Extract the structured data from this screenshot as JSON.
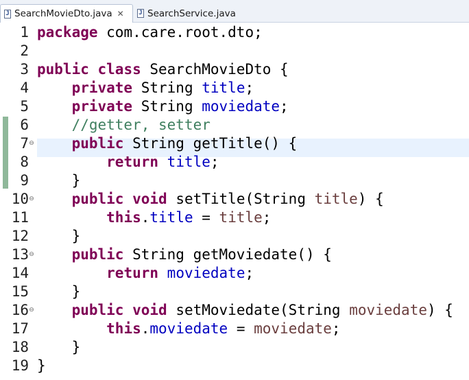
{
  "tabs": [
    {
      "label": "SearchMovieDto.java",
      "icon": "java-file-icon",
      "active": true,
      "close": "✕"
    },
    {
      "label": "SearchService.java",
      "icon": "java-file-icon",
      "active": false
    }
  ],
  "editor": {
    "highlighted_line": 6,
    "lines": [
      {
        "n": "1",
        "fold": "",
        "tokens": [
          {
            "t": "package",
            "c": "kw"
          },
          {
            "t": " com.care.root.dto;",
            "c": ""
          }
        ]
      },
      {
        "n": "2",
        "fold": "",
        "tokens": []
      },
      {
        "n": "3",
        "fold": "",
        "tokens": [
          {
            "t": "public",
            "c": "kw"
          },
          {
            "t": " ",
            "c": ""
          },
          {
            "t": "class",
            "c": "kw"
          },
          {
            "t": " SearchMovieDto {",
            "c": ""
          }
        ]
      },
      {
        "n": "4",
        "fold": "",
        "tokens": [
          {
            "t": "    ",
            "c": ""
          },
          {
            "t": "private",
            "c": "kw"
          },
          {
            "t": " String ",
            "c": ""
          },
          {
            "t": "title",
            "c": "fld"
          },
          {
            "t": ";",
            "c": ""
          }
        ]
      },
      {
        "n": "5",
        "fold": "",
        "tokens": [
          {
            "t": "    ",
            "c": ""
          },
          {
            "t": "private",
            "c": "kw"
          },
          {
            "t": " String ",
            "c": ""
          },
          {
            "t": "moviedate",
            "c": "fld"
          },
          {
            "t": ";",
            "c": ""
          }
        ]
      },
      {
        "n": "6",
        "fold": "",
        "tokens": [
          {
            "t": "    ",
            "c": ""
          },
          {
            "t": "//getter, setter",
            "c": "cmt"
          }
        ]
      },
      {
        "n": "7",
        "fold": "⊖",
        "tokens": [
          {
            "t": "    ",
            "c": ""
          },
          {
            "t": "public",
            "c": "kw"
          },
          {
            "t": " String getTitle() {",
            "c": ""
          }
        ]
      },
      {
        "n": "8",
        "fold": "",
        "tokens": [
          {
            "t": "        ",
            "c": ""
          },
          {
            "t": "return",
            "c": "kw"
          },
          {
            "t": " ",
            "c": ""
          },
          {
            "t": "title",
            "c": "fld"
          },
          {
            "t": ";",
            "c": ""
          }
        ]
      },
      {
        "n": "9",
        "fold": "",
        "tokens": [
          {
            "t": "    }",
            "c": ""
          }
        ]
      },
      {
        "n": "10",
        "fold": "⊖",
        "tokens": [
          {
            "t": "    ",
            "c": ""
          },
          {
            "t": "public",
            "c": "kw"
          },
          {
            "t": " ",
            "c": ""
          },
          {
            "t": "void",
            "c": "kw"
          },
          {
            "t": " setTitle(String ",
            "c": ""
          },
          {
            "t": "title",
            "c": "param"
          },
          {
            "t": ") {",
            "c": ""
          }
        ]
      },
      {
        "n": "11",
        "fold": "",
        "tokens": [
          {
            "t": "        ",
            "c": ""
          },
          {
            "t": "this",
            "c": "kw"
          },
          {
            "t": ".",
            "c": ""
          },
          {
            "t": "title",
            "c": "fld"
          },
          {
            "t": " = ",
            "c": ""
          },
          {
            "t": "title",
            "c": "param"
          },
          {
            "t": ";",
            "c": ""
          }
        ]
      },
      {
        "n": "12",
        "fold": "",
        "tokens": [
          {
            "t": "    }",
            "c": ""
          }
        ]
      },
      {
        "n": "13",
        "fold": "⊖",
        "tokens": [
          {
            "t": "    ",
            "c": ""
          },
          {
            "t": "public",
            "c": "kw"
          },
          {
            "t": " String getMoviedate() {",
            "c": ""
          }
        ]
      },
      {
        "n": "14",
        "fold": "",
        "tokens": [
          {
            "t": "        ",
            "c": ""
          },
          {
            "t": "return",
            "c": "kw"
          },
          {
            "t": " ",
            "c": ""
          },
          {
            "t": "moviedate",
            "c": "fld"
          },
          {
            "t": ";",
            "c": ""
          }
        ]
      },
      {
        "n": "15",
        "fold": "",
        "tokens": [
          {
            "t": "    }",
            "c": ""
          }
        ]
      },
      {
        "n": "16",
        "fold": "⊖",
        "tokens": [
          {
            "t": "    ",
            "c": ""
          },
          {
            "t": "public",
            "c": "kw"
          },
          {
            "t": " ",
            "c": ""
          },
          {
            "t": "void",
            "c": "kw"
          },
          {
            "t": " setMoviedate(String ",
            "c": ""
          },
          {
            "t": "moviedate",
            "c": "param"
          },
          {
            "t": ") {",
            "c": ""
          }
        ]
      },
      {
        "n": "17",
        "fold": "",
        "tokens": [
          {
            "t": "        ",
            "c": ""
          },
          {
            "t": "this",
            "c": "kw"
          },
          {
            "t": ".",
            "c": ""
          },
          {
            "t": "moviedate",
            "c": "fld"
          },
          {
            "t": " = ",
            "c": ""
          },
          {
            "t": "moviedate",
            "c": "param"
          },
          {
            "t": ";",
            "c": ""
          }
        ]
      },
      {
        "n": "18",
        "fold": "",
        "tokens": [
          {
            "t": "    }",
            "c": ""
          }
        ]
      },
      {
        "n": "19",
        "fold": "",
        "tokens": [
          {
            "t": "}",
            "c": ""
          }
        ]
      }
    ]
  }
}
